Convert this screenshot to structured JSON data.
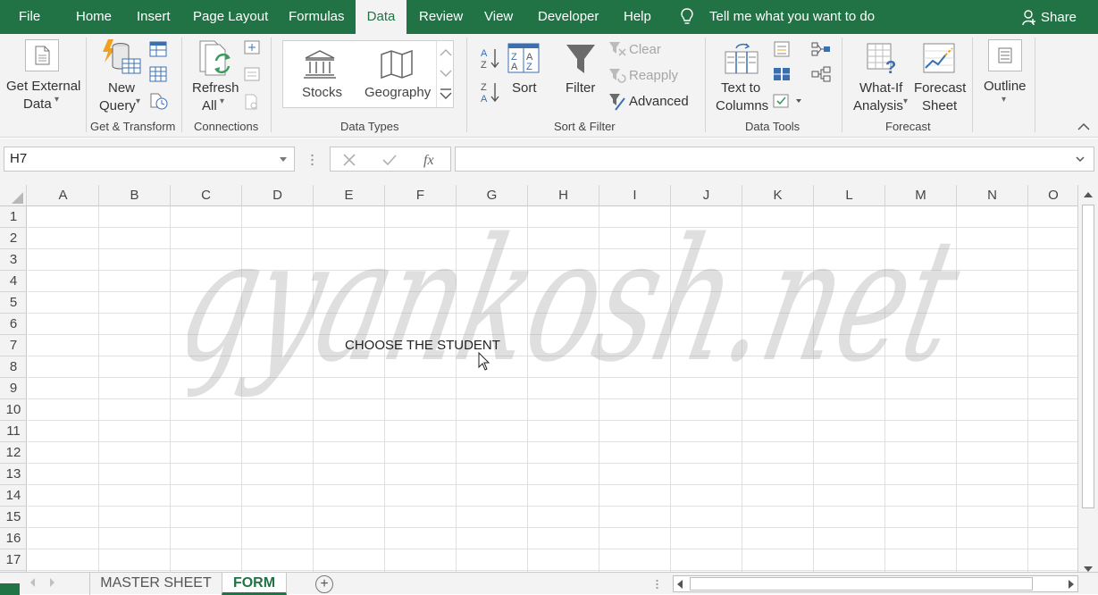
{
  "tabs": [
    "File",
    "Home",
    "Insert",
    "Page Layout",
    "Formulas",
    "Data",
    "Review",
    "View",
    "Developer",
    "Help"
  ],
  "active_tab": "Data",
  "tell_me": "Tell me what you want to do",
  "share": "Share",
  "ribbon": {
    "get_external": [
      "Get External",
      "Data"
    ],
    "new_query": [
      "New",
      "Query"
    ],
    "refresh": [
      "Refresh",
      "All"
    ],
    "stocks": "Stocks",
    "geography": "Geography",
    "sort": "Sort",
    "filter": "Filter",
    "clear": "Clear",
    "reapply": "Reapply",
    "advanced": "Advanced",
    "text_to_columns": [
      "Text to",
      "Columns"
    ],
    "what_if": [
      "What-If",
      "Analysis"
    ],
    "forecast_sheet": [
      "Forecast",
      "Sheet"
    ],
    "outline": "Outline",
    "groups": {
      "get_transform": "Get & Transform",
      "connections": "Connections",
      "data_types": "Data Types",
      "sort_filter": "Sort & Filter",
      "data_tools": "Data Tools",
      "forecast": "Forecast"
    }
  },
  "formula_bar": {
    "name_box": "H7",
    "formula": ""
  },
  "columns": [
    "A",
    "B",
    "C",
    "D",
    "E",
    "F",
    "G",
    "H",
    "I",
    "J",
    "K",
    "L",
    "M",
    "N",
    "O"
  ],
  "rows": [
    "1",
    "2",
    "3",
    "4",
    "5",
    "6",
    "7",
    "8",
    "9",
    "10",
    "11",
    "12",
    "13",
    "14",
    "15",
    "16",
    "17"
  ],
  "cell_text": "CHOOSE THE STUDENT",
  "watermark": "gyankosh.net",
  "sheets": [
    "MASTER SHEET",
    "FORM"
  ],
  "active_sheet": "FORM",
  "colors": {
    "accent": "#217346",
    "ribbon_bg": "#f3f3f3"
  }
}
